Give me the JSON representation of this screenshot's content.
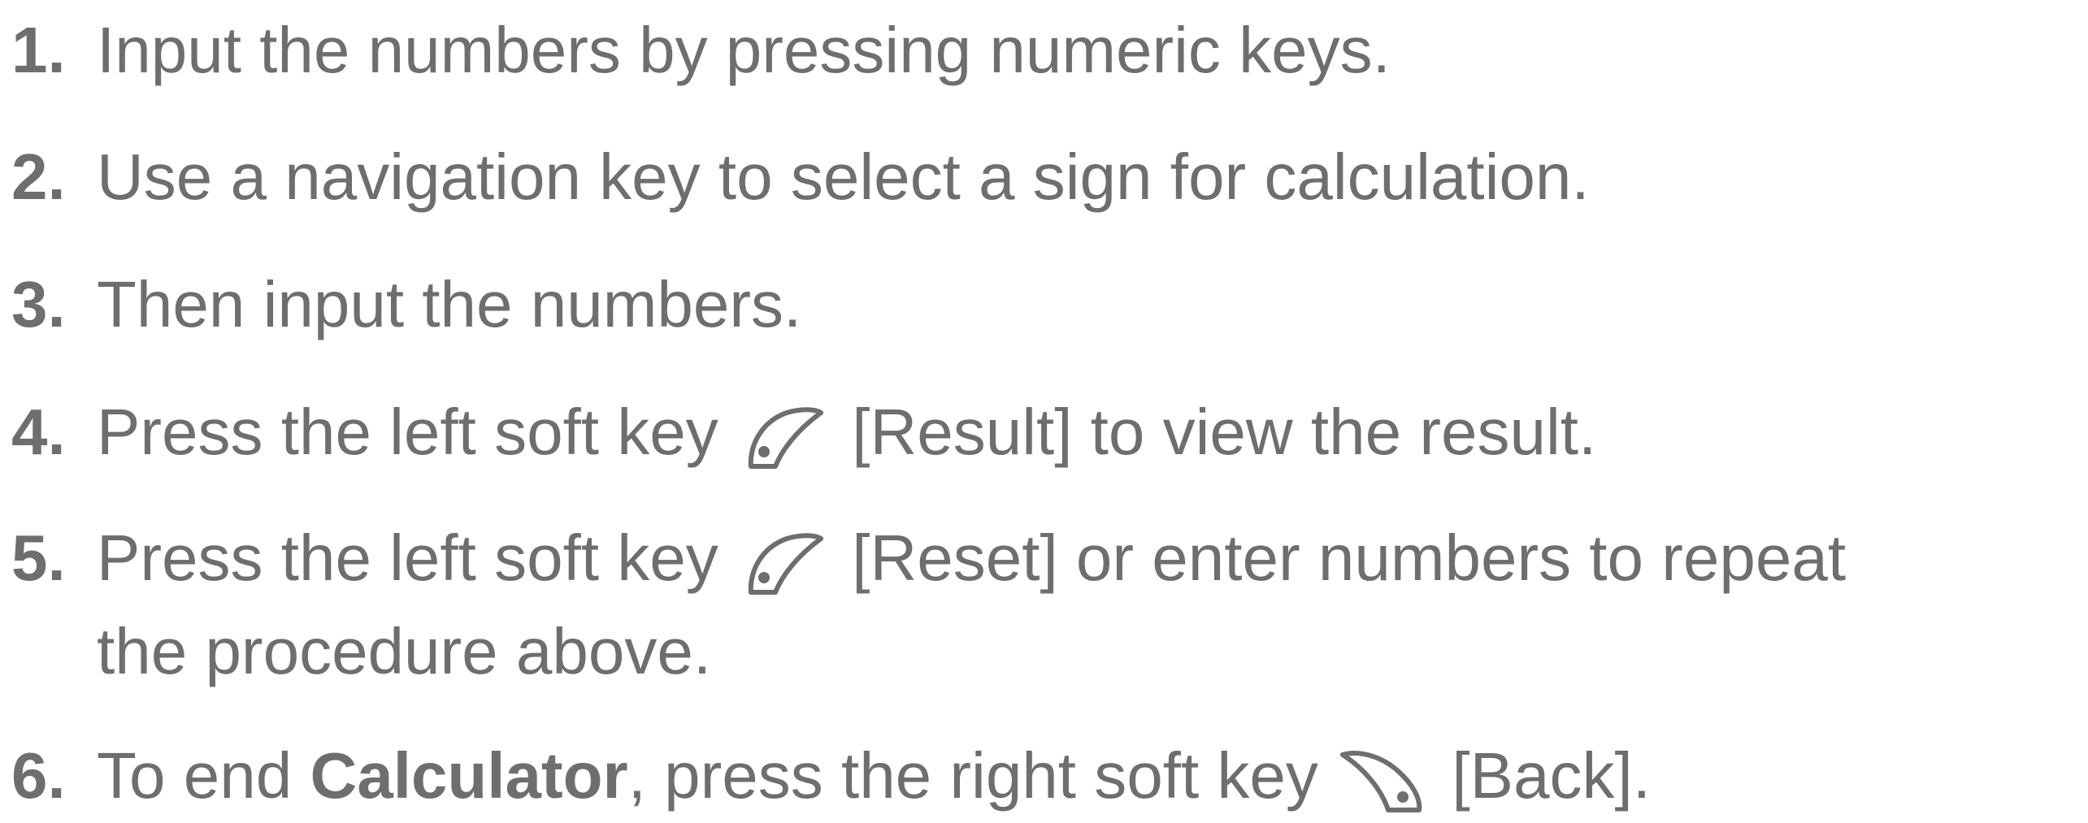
{
  "steps": [
    {
      "num": "1.",
      "text": "Input the numbers by pressing numeric keys."
    },
    {
      "num": "2.",
      "text": "Use a navigation key to select a sign for calculation."
    },
    {
      "num": "3.",
      "text": "Then input the numbers."
    },
    {
      "num": "4.",
      "before": "Press the left soft key",
      "icon": "left-soft-key-icon",
      "after": "[Result] to view the result."
    },
    {
      "num": "5.",
      "before": "Press the left soft key",
      "icon": "left-soft-key-icon",
      "after": "[Reset] or enter numbers to repeat",
      "continuation": "the procedure above."
    },
    {
      "num": "6.",
      "before": "To end",
      "bold": "Calculator",
      "middle": ", press the right soft key",
      "icon": "right-soft-key-icon",
      "after": "[Back]."
    }
  ],
  "colors": {
    "text": "#6e6e6e"
  }
}
